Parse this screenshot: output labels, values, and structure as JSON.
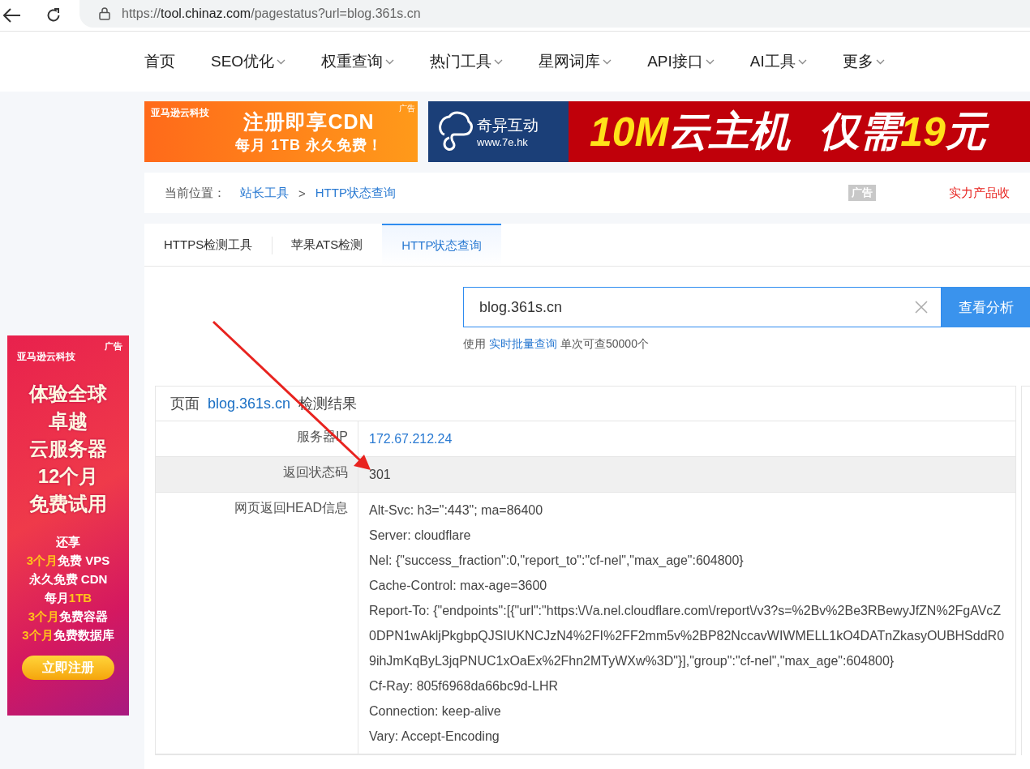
{
  "browser": {
    "url_scheme": "https://",
    "url_host": "tool.chinaz.com",
    "url_path": "/pagestatus?url=blog.361s.cn"
  },
  "nav": {
    "items": [
      {
        "label": "首页",
        "dropdown": false
      },
      {
        "label": "SEO优化",
        "dropdown": true
      },
      {
        "label": "权重查询",
        "dropdown": true
      },
      {
        "label": "热门工具",
        "dropdown": true
      },
      {
        "label": "星网词库",
        "dropdown": true
      },
      {
        "label": "API接口",
        "dropdown": true
      },
      {
        "label": "AI工具",
        "dropdown": true
      },
      {
        "label": "更多",
        "dropdown": true
      }
    ]
  },
  "top_ads": [
    {
      "kind": "cdn",
      "brand": "亚马逊云科技",
      "tag": "广告",
      "lines": [
        "注册即享CDN",
        "每月 1TB 永久免费！"
      ]
    },
    {
      "kind": "host",
      "brand": "奇异互动",
      "site": "www.7e.hk",
      "segments": [
        {
          "text": "10M",
          "highlight": true
        },
        {
          "text": "云主机",
          "highlight": false
        },
        {
          "text": "仅需",
          "highlight": false
        },
        {
          "text": "19",
          "highlight": true
        },
        {
          "text": "元",
          "highlight": false
        }
      ]
    }
  ],
  "breadcrumb": {
    "label": "当前位置：",
    "links": [
      "站长工具",
      "HTTP状态查询"
    ],
    "separator": ">",
    "ad_tag": "广告",
    "ad_text": "实力产品收"
  },
  "tabs": [
    {
      "label": "HTTPS检测工具",
      "selected": false
    },
    {
      "label": "苹果ATS检测",
      "selected": false
    },
    {
      "label": "HTTP状态查询",
      "selected": true
    }
  ],
  "search": {
    "value": "blog.361s.cn",
    "button": "查看分析",
    "hint_before": "使用",
    "hint_link": "实时批量查询",
    "hint_after": "单次可查50000个"
  },
  "result": {
    "title_before": "页面",
    "title_link": "blog.361s.cn",
    "title_after": "检测结果",
    "rows": [
      {
        "label": "服务器IP",
        "kind": "link",
        "highlighted": false,
        "lines": [
          "172.67.212.24"
        ]
      },
      {
        "label": "返回状态码",
        "kind": "text",
        "highlighted": true,
        "lines": [
          "301"
        ]
      },
      {
        "label": "网页返回HEAD信息",
        "kind": "text",
        "highlighted": false,
        "lines": [
          "Alt-Svc: h3=\":443\"; ma=86400",
          "Server: cloudflare",
          "Nel: {\"success_fraction\":0,\"report_to\":\"cf-nel\",\"max_age\":604800}",
          "Cache-Control: max-age=3600",
          "Report-To: {\"endpoints\":[{\"url\":\"https:\\/\\/a.nel.cloudflare.com\\/report\\/v3?s=%2Bv%2Be3RBewyJfZN%2FgAVcZ0DPN1wAkljPkgbpQJSIUKNCJzN4%2FI%2FF2mm5v%2BP82NccavWIWMELL1kO4DATnZkasyOUBHSddR09ihJmKqByL3jqPNUC1xOaEx%2Fhn2MTyWXw%3D\"}],\"group\":\"cf-nel\",\"max_age\":604800}",
          "Cf-Ray: 805f6968da66bc9d-LHR",
          "Connection: keep-alive",
          "Vary: Accept-Encoding"
        ]
      }
    ]
  },
  "side_ad": {
    "tag": "广告",
    "brand": "亚马逊云科技",
    "headline": [
      "体验全球",
      "卓越",
      "云服务器",
      "12个月",
      "免费试用"
    ],
    "offers": [
      [
        {
          "text": "还享",
          "highlight": false
        }
      ],
      [
        {
          "text": "3个月",
          "highlight": true
        },
        {
          "text": "免费 VPS",
          "highlight": false
        }
      ],
      [
        {
          "text": "永久免费 CDN",
          "highlight": false
        }
      ],
      [
        {
          "text": "每月",
          "highlight": false
        },
        {
          "text": "1TB",
          "highlight": true
        }
      ],
      [
        {
          "text": "3个月",
          "highlight": true
        },
        {
          "text": "免费容器",
          "highlight": false
        }
      ],
      [
        {
          "text": "3个月",
          "highlight": true
        },
        {
          "text": "免费数据库",
          "highlight": false
        }
      ]
    ],
    "button": "立即注册"
  }
}
